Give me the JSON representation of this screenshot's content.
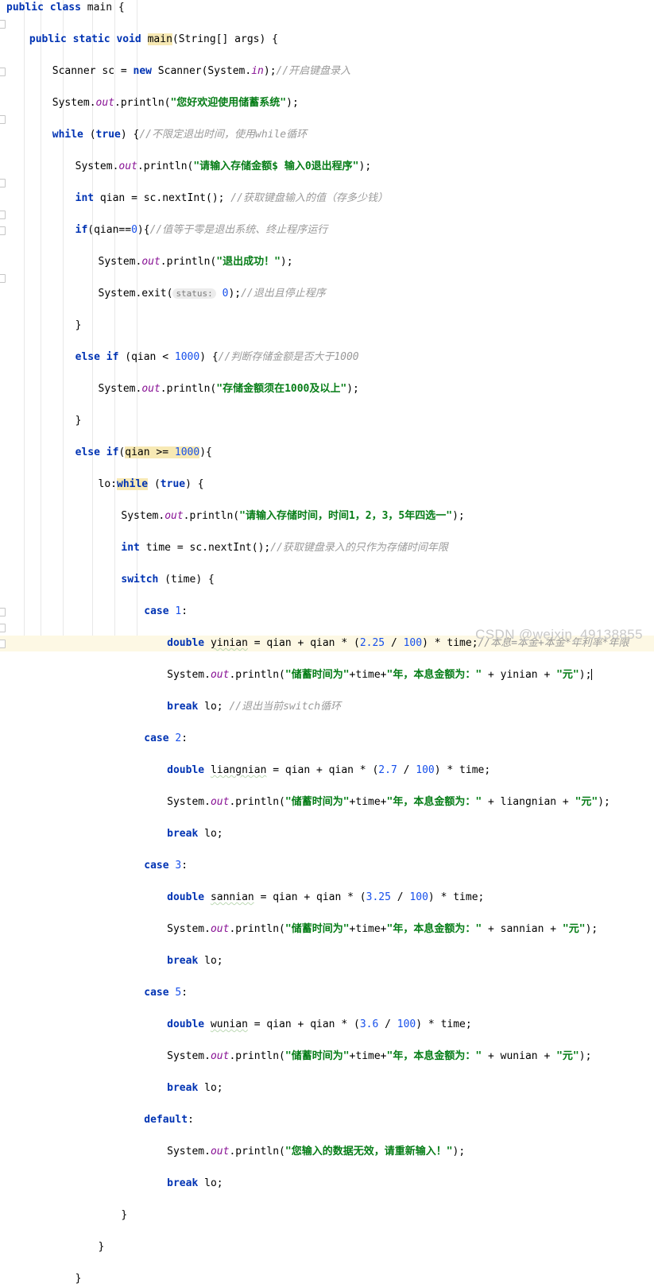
{
  "app": {
    "kind": "java-code-editor",
    "language": "Java",
    "theme": "IntelliJ Light",
    "watermark": "CSDN @weixin_49138855"
  },
  "colors": {
    "background": "#ffffff",
    "keyword": "#0033b3",
    "string": "#067d17",
    "number": "#1750eb",
    "comment": "#9a9a9a",
    "field": "#871094",
    "plain": "#080808",
    "identifier_highlight": "#f7e9b4",
    "current_line": "#fdf8e4",
    "indent_guide": "#e8e8e8",
    "watermark": "#c9c9c9"
  },
  "metrics": {
    "line_height": 20,
    "font_size": 13,
    "char_width": 7.22,
    "text_left": 8
  },
  "indent_guides_x": [
    30,
    51,
    79,
    116,
    144,
    172
  ],
  "fold_marker_rows": [
    1,
    4,
    7,
    11,
    13,
    14,
    17,
    38,
    39,
    40
  ],
  "current_line_index": 20,
  "caret_line_index": 20,
  "code_lines": [
    {
      "i": 0,
      "indent": 0,
      "html": "<span class=\"kw\">public class</span> <span class=\"pln\">main</span> {"
    },
    {
      "i": 1,
      "indent": 1,
      "html": "<span class=\"kw\">public static void</span> <span class=\"hl\">main</span>(String[] args) {"
    },
    {
      "i": 2,
      "indent": 2,
      "html": "Scanner sc = <span class=\"kw\">new</span> Scanner(System.<span class=\"fld\">in</span>);<span class=\"cmt\">//开启键盘录入</span>"
    },
    {
      "i": 3,
      "indent": 2,
      "html": "System.<span class=\"fld\">out</span>.println(<span class=\"str\">\"您好欢迎使用储蓄系统\"</span>);"
    },
    {
      "i": 4,
      "indent": 2,
      "html": "<span class=\"kw\">while</span> (<span class=\"kw\">true</span>) {<span class=\"cmt\">//不限定退出时间，使用while循环</span>"
    },
    {
      "i": 5,
      "indent": 3,
      "html": "System.<span class=\"fld\">out</span>.println(<span class=\"str\">\"请输入存储金额$ 输入0退出程序\"</span>);"
    },
    {
      "i": 6,
      "indent": 3,
      "html": "<span class=\"kw\">int</span> qian = sc.nextInt(); <span class=\"cmt\">//获取键盘输入的值（存多少钱）</span>"
    },
    {
      "i": 7,
      "indent": 3,
      "html": "<span class=\"kw\">if</span>(qian==<span class=\"num\">0</span>){<span class=\"cmt\">//值等于零是退出系统、终止程序运行</span>"
    },
    {
      "i": 8,
      "indent": 4,
      "html": "System.<span class=\"fld\">out</span>.println(<span class=\"str\">\"退出成功！\"</span>);"
    },
    {
      "i": 9,
      "indent": 4,
      "html": "System.exit(<span class=\"hint\">status:</span> <span class=\"num\">0</span>);<span class=\"cmt\">//退出且停止程序</span>"
    },
    {
      "i": 10,
      "indent": 3,
      "html": "}"
    },
    {
      "i": 11,
      "indent": 3,
      "html": "<span class=\"kw\">else if</span> (qian &lt; <span class=\"num\">1000</span>) {<span class=\"cmt\">//判断存储金额是否大于1000</span>"
    },
    {
      "i": 12,
      "indent": 4,
      "html": "System.<span class=\"fld\">out</span>.println(<span class=\"str\">\"存储金额须在1000及以上\"</span>);"
    },
    {
      "i": 13,
      "indent": 3,
      "html": "}"
    },
    {
      "i": 14,
      "indent": 3,
      "html": "<span class=\"kw\">else if</span>(<span class=\"hl\">qian &gt;= <span class=\"num\">1000</span></span>){"
    },
    {
      "i": 15,
      "indent": 4,
      "html": "lo:<span class=\"hl\"><span class=\"kw\">while</span></span> (<span class=\"kw\">true</span>) {"
    },
    {
      "i": 16,
      "indent": 5,
      "html": "System.<span class=\"fld\">out</span>.println(<span class=\"str\">\"请输入存储时间，时间1，2，3，5年四选一\"</span>);"
    },
    {
      "i": 17,
      "indent": 5,
      "html": "<span class=\"kw\">int</span> time = sc.nextInt();<span class=\"cmt\">//获取键盘录入的只作为存储时间年限</span>"
    },
    {
      "i": 18,
      "indent": 5,
      "html": "<span class=\"kw\">switch</span> (time) {"
    },
    {
      "i": 19,
      "indent": 6,
      "html": "<span class=\"kw\">case</span> <span class=\"num\">1</span>:"
    },
    {
      "i": 20,
      "indent": 7,
      "html": "<span class=\"kw\">double</span> <span class=\"sq\">yinian</span> = qian + qian * (<span class=\"num\">2.25</span> / <span class=\"num\">100</span>) * time;<span class=\"cmt\">//本息=本金+本金*年利率*年限</span>"
    },
    {
      "i": 21,
      "indent": 7,
      "html": "System.<span class=\"fld\">out</span>.println(<span class=\"str\">\"储蓄时间为\"</span>+time+<span class=\"str\">\"年，本息金额为：\"</span> + yinian + <span class=\"str\">\"元\"</span>);<span class=\"caret\"></span>"
    },
    {
      "i": 22,
      "indent": 7,
      "html": "<span class=\"kw\">break</span> lo; <span class=\"cmt\">//退出当前switch循环</span>"
    },
    {
      "i": 23,
      "indent": 6,
      "html": "<span class=\"kw\">case</span> <span class=\"num\">2</span>:"
    },
    {
      "i": 24,
      "indent": 7,
      "html": "<span class=\"kw\">double</span> <span class=\"sq\">liangnian</span> = qian + qian * (<span class=\"num\">2.7</span> / <span class=\"num\">100</span>) * time;"
    },
    {
      "i": 25,
      "indent": 7,
      "html": "System.<span class=\"fld\">out</span>.println(<span class=\"str\">\"储蓄时间为\"</span>+time+<span class=\"str\">\"年，本息金额为：\"</span> + liangnian + <span class=\"str\">\"元\"</span>);"
    },
    {
      "i": 26,
      "indent": 7,
      "html": "<span class=\"kw\">break</span> lo;"
    },
    {
      "i": 27,
      "indent": 6,
      "html": "<span class=\"kw\">case</span> <span class=\"num\">3</span>:"
    },
    {
      "i": 28,
      "indent": 7,
      "html": "<span class=\"kw\">double</span> <span class=\"sq\">sannian</span> = qian + qian * (<span class=\"num\">3.25</span> / <span class=\"num\">100</span>) * time;"
    },
    {
      "i": 29,
      "indent": 7,
      "html": "System.<span class=\"fld\">out</span>.println(<span class=\"str\">\"储蓄时间为\"</span>+time+<span class=\"str\">\"年，本息金额为：\"</span> + sannian + <span class=\"str\">\"元\"</span>);"
    },
    {
      "i": 30,
      "indent": 7,
      "html": "<span class=\"kw\">break</span> lo;"
    },
    {
      "i": 31,
      "indent": 6,
      "html": "<span class=\"kw\">case</span> <span class=\"num\">5</span>:"
    },
    {
      "i": 32,
      "indent": 7,
      "html": "<span class=\"kw\">double</span> <span class=\"sq\">wunian</span> = qian + qian * (<span class=\"num\">3.6</span> / <span class=\"num\">100</span>) * time;"
    },
    {
      "i": 33,
      "indent": 7,
      "html": "System.<span class=\"fld\">out</span>.println(<span class=\"str\">\"储蓄时间为\"</span>+time+<span class=\"str\">\"年，本息金额为：\"</span> + wunian + <span class=\"str\">\"元\"</span>);"
    },
    {
      "i": 34,
      "indent": 7,
      "html": "<span class=\"kw\">break</span> lo;"
    },
    {
      "i": 35,
      "indent": 6,
      "html": "<span class=\"kw\">default</span>:"
    },
    {
      "i": 36,
      "indent": 7,
      "html": "System.<span class=\"fld\">out</span>.println(<span class=\"str\">\"您输入的数据无效，请重新输入！\"</span>);"
    },
    {
      "i": 37,
      "indent": 7,
      "html": "<span class=\"kw\">break</span> lo;"
    },
    {
      "i": 38,
      "indent": 5,
      "html": "}"
    },
    {
      "i": 39,
      "indent": 4,
      "html": "}"
    },
    {
      "i": 40,
      "indent": 3,
      "html": "}"
    }
  ],
  "plain_text_lines": [
    "public class main {",
    "    public static void main(String[] args) {",
    "        Scanner sc = new Scanner(System.in);//开启键盘录入",
    "        System.out.println(\"您好欢迎使用储蓄系统\");",
    "        while (true) {//不限定退出时间，使用while循环",
    "            System.out.println(\"请输入存储金额$ 输入0退出程序\");",
    "            int qian = sc.nextInt(); //获取键盘输入的值（存多少钱）",
    "            if(qian==0){//值等于零是退出系统、终止程序运行",
    "                System.out.println(\"退出成功！\");",
    "                System.exit(0);//退出且停止程序",
    "            }",
    "            else if (qian < 1000) {//判断存储金额是否大于1000",
    "                System.out.println(\"存储金额须在1000及以上\");",
    "            }",
    "            else if(qian >= 1000){",
    "                lo:while (true) {",
    "                    System.out.println(\"请输入存储时间，时间1，2，3，5年四选一\");",
    "                    int time = sc.nextInt();//获取键盘录入的只作为存储时间年限",
    "                    switch (time) {",
    "                        case 1:",
    "                            double yinian = qian + qian * (2.25 / 100) * time;//本息=本金+本金*年利率*年限",
    "                            System.out.println(\"储蓄时间为\"+time+\"年，本息金额为：\" + yinian + \"元\");",
    "                            break lo; //退出当前switch循环",
    "                        case 2:",
    "                            double liangnian = qian + qian * (2.7 / 100) * time;",
    "                            System.out.println(\"储蓄时间为\"+time+\"年，本息金额为：\" + liangnian + \"元\");",
    "                            break lo;",
    "                        case 3:",
    "                            double sannian = qian + qian * (3.25 / 100) * time;",
    "                            System.out.println(\"储蓄时间为\"+time+\"年，本息金额为：\" + sannian + \"元\");",
    "                            break lo;",
    "                        case 5:",
    "                            double wunian = qian + qian * (3.6 / 100) * time;",
    "                            System.out.println(\"储蓄时间为\"+time+\"年，本息金额为：\" + wunian + \"元\");",
    "                            break lo;",
    "                        default:",
    "                            System.out.println(\"您输入的数据无效，请重新输入！\");",
    "                            break lo;",
    "                    }",
    "                }",
    "            }"
  ]
}
